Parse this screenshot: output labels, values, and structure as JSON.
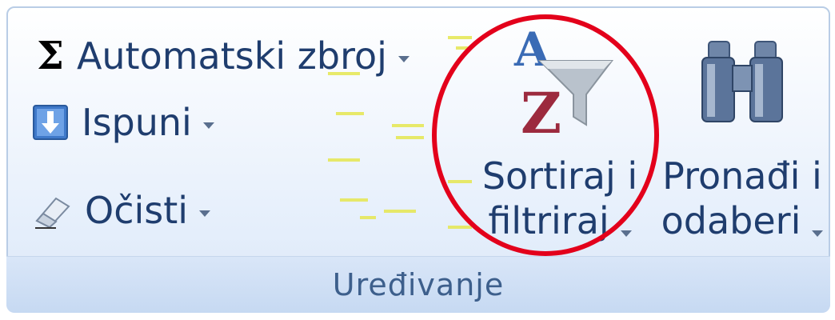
{
  "group": {
    "title": "Uređivanje"
  },
  "commands": {
    "autosum": {
      "label": "Automatski zbroj",
      "icon": "sigma-icon"
    },
    "fill": {
      "label": "Ispuni",
      "icon": "fill-down-icon"
    },
    "clear": {
      "label": "Očisti",
      "icon": "eraser-icon"
    }
  },
  "sort_filter": {
    "line1": "Sortiraj i",
    "line2": "filtriraj",
    "icon": "sort-az-funnel-icon"
  },
  "find_select": {
    "line1": "Pronađi i",
    "line2": "odaberi",
    "icon": "binoculars-icon"
  },
  "annotation": {
    "color": "#e3001b"
  },
  "colors": {
    "text": "#1f3d6e",
    "group_title": "#3d5f8c",
    "border": "#b9cde6"
  }
}
